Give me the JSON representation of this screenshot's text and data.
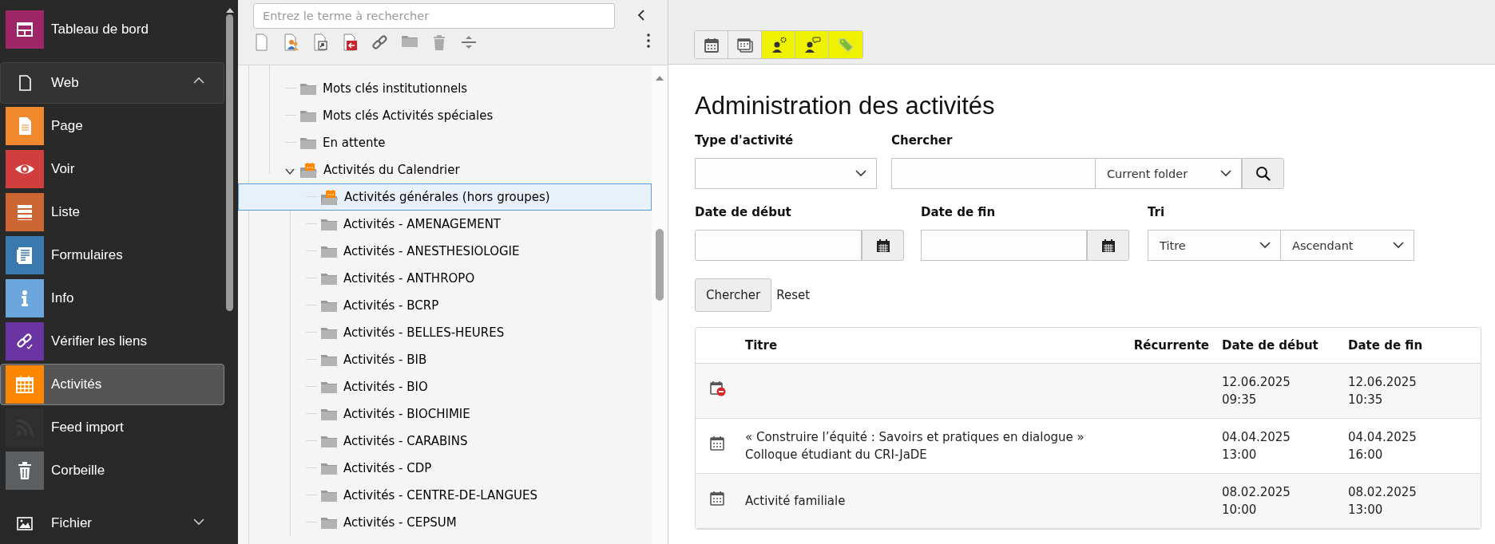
{
  "sidebar": {
    "items": [
      {
        "label": "Tableau de bord",
        "kind": "module",
        "color": "#9e2667",
        "selected": false
      },
      {
        "label": "Web",
        "kind": "group",
        "expanded": true
      },
      {
        "label": "Page",
        "kind": "module",
        "color": "#f0892e",
        "selected": false
      },
      {
        "label": "Voir",
        "kind": "module",
        "color": "#d13e3e",
        "selected": false
      },
      {
        "label": "Liste",
        "kind": "module",
        "color": "#cc6633",
        "selected": false
      },
      {
        "label": "Formulaires",
        "kind": "module",
        "color": "#3a78b0",
        "selected": false
      },
      {
        "label": "Info",
        "kind": "module",
        "color": "#6ba6dc",
        "selected": false
      },
      {
        "label": "Vérifier les liens",
        "kind": "module",
        "color": "#6a35a3",
        "selected": false
      },
      {
        "label": "Activités",
        "kind": "module",
        "color": "#ff8700",
        "selected": true
      },
      {
        "label": "Feed import",
        "kind": "module",
        "color": "#2f2f2f",
        "selected": false
      },
      {
        "label": "Corbeille",
        "kind": "module",
        "color": "#5b5f61",
        "selected": false
      },
      {
        "label": "Fichier",
        "kind": "group",
        "expanded": false
      }
    ]
  },
  "tree": {
    "search": {
      "placeholder": "Entrez le terme à rechercher"
    },
    "items": [
      {
        "label": "Mots clés institutionnels",
        "kind": "folder",
        "selected": false
      },
      {
        "label": "Mots clés Activités spéciales",
        "kind": "folder",
        "selected": false
      },
      {
        "label": "En attente",
        "kind": "folder",
        "selected": false
      },
      {
        "label": "Activités du Calendrier",
        "kind": "calendar-folder",
        "selected": false,
        "expanded": true,
        "children": [
          {
            "label": "Activités générales (hors groupes)",
            "kind": "calendar-folder",
            "selected": true
          },
          {
            "label": "Activités - AMENAGEMENT",
            "kind": "folder",
            "selected": false
          },
          {
            "label": "Activités - ANESTHESIOLOGIE",
            "kind": "folder",
            "selected": false
          },
          {
            "label": "Activités - ANTHROPO",
            "kind": "folder",
            "selected": false
          },
          {
            "label": "Activités - BCRP",
            "kind": "folder",
            "selected": false
          },
          {
            "label": "Activités - BELLES-HEURES",
            "kind": "folder",
            "selected": false
          },
          {
            "label": "Activités - BIB",
            "kind": "folder",
            "selected": false
          },
          {
            "label": "Activités - BIO",
            "kind": "folder",
            "selected": false
          },
          {
            "label": "Activités - BIOCHIMIE",
            "kind": "folder",
            "selected": false
          },
          {
            "label": "Activités - CARABINS",
            "kind": "folder",
            "selected": false
          },
          {
            "label": "Activités - CDP",
            "kind": "folder",
            "selected": false
          },
          {
            "label": "Activités - CENTRE-DE-LANGUES",
            "kind": "folder",
            "selected": false
          },
          {
            "label": "Activités - CEPSUM",
            "kind": "folder",
            "selected": false
          }
        ]
      }
    ]
  },
  "toolbar": [
    {
      "highlighted": false
    },
    {
      "highlighted": false
    },
    {
      "highlighted": true
    },
    {
      "highlighted": true
    },
    {
      "highlighted": true
    }
  ],
  "heading": "Administration des activités",
  "form": {
    "type": {
      "label": "Type d'activité"
    },
    "search": {
      "label": "Chercher",
      "scope": "Current folder"
    },
    "start_date": {
      "label": "Date de début"
    },
    "end_date": {
      "label": "Date de fin"
    },
    "sort": {
      "label": "Tri",
      "field": "Titre",
      "order": "Ascendant"
    },
    "submit": "Chercher",
    "reset": "Reset"
  },
  "table": {
    "columns": [
      "Titre",
      "Récurrente",
      "Date de début",
      "Date de fin"
    ],
    "rows": [
      {
        "kind": "hidden",
        "start": "12.06.2025\n09:35",
        "end": "12.06.2025\n10:35"
      },
      {
        "kind": "event",
        "title": "« Construire l’équité : Savoirs et pratiques en dialogue »\nColloque étudiant du CRI-JaDE",
        "start": "04.04.2025\n13:00",
        "end": "04.04.2025\n16:00"
      },
      {
        "kind": "event",
        "title": "Activité familiale",
        "start": "08.02.2025\n10:00",
        "end": "08.02.2025\n13:00"
      }
    ]
  }
}
